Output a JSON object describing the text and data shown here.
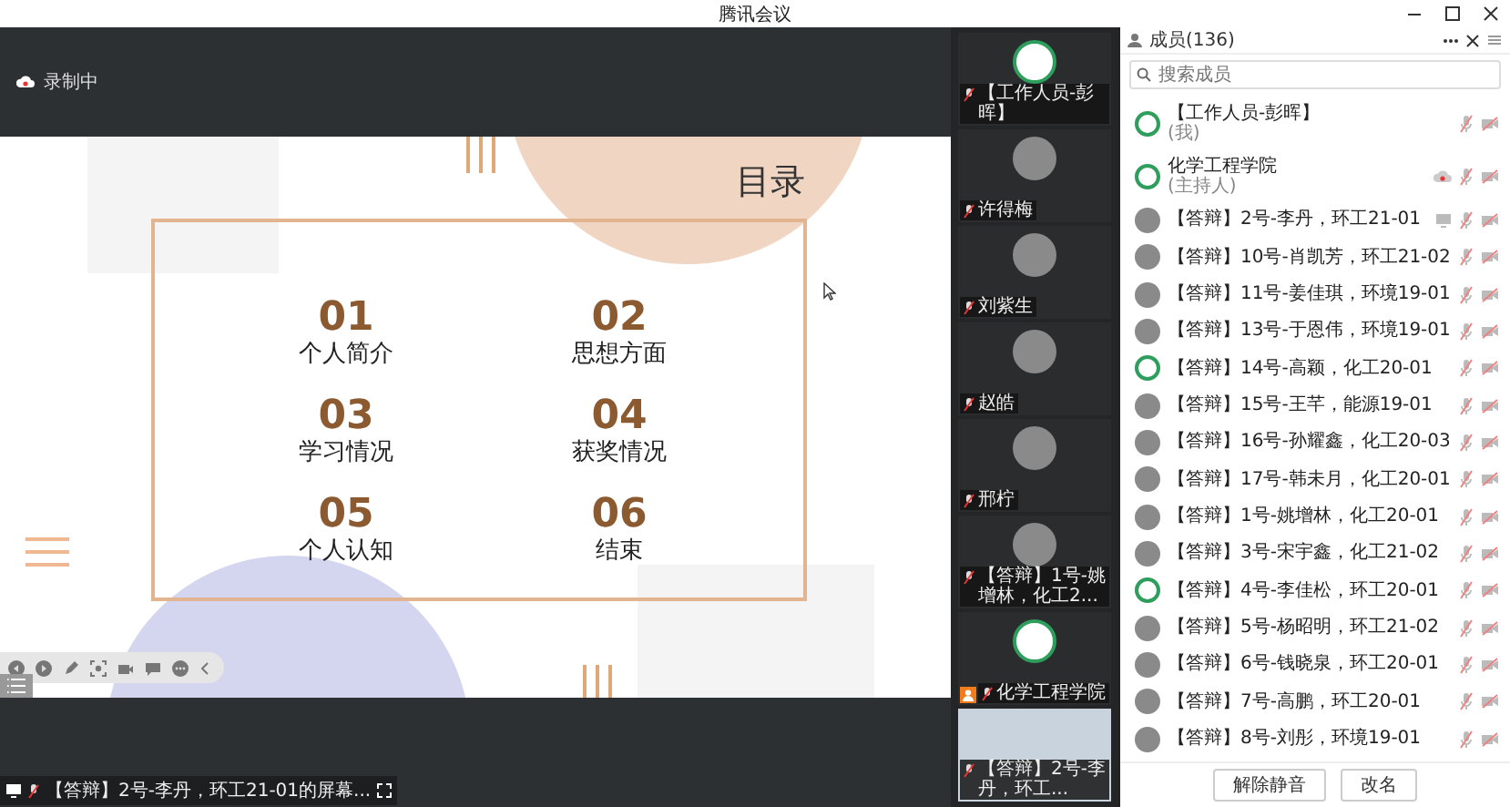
{
  "window": {
    "title": "腾讯会议"
  },
  "recording": {
    "label": "录制中"
  },
  "slide": {
    "title": "目录",
    "items": [
      {
        "number": "01",
        "label": "个人简介"
      },
      {
        "number": "02",
        "label": "思想方面"
      },
      {
        "number": "03",
        "label": "学习情况"
      },
      {
        "number": "04",
        "label": "获奖情况"
      },
      {
        "number": "05",
        "label": "个人认知"
      },
      {
        "number": "06",
        "label": "结束"
      }
    ]
  },
  "screen_share": {
    "label": "【答辩】2号-李丹，环工21-01的屏幕..."
  },
  "video_tiles": [
    {
      "name": "【工作人员-彭晖】",
      "kind": "logo",
      "muted": true,
      "host": false
    },
    {
      "name": "许得梅",
      "kind": "photo",
      "muted": true,
      "host": false
    },
    {
      "name": "刘紫生",
      "kind": "photo",
      "muted": true,
      "host": false
    },
    {
      "name": "赵皓",
      "kind": "photo",
      "muted": true,
      "host": false
    },
    {
      "name": "邢柠",
      "kind": "photo",
      "muted": true,
      "host": false
    },
    {
      "name": "【答辩】1号-姚增林，化工2...",
      "kind": "photo",
      "muted": true,
      "host": false
    },
    {
      "name": "化学工程学院",
      "kind": "logo",
      "muted": true,
      "host": true
    },
    {
      "name": "【答辩】2号-李丹，环工...",
      "kind": "video",
      "muted": true,
      "host": false
    }
  ],
  "members": {
    "title": "成员(136)",
    "search": {
      "placeholder": "搜索成员"
    },
    "items": [
      {
        "name": "【工作人员-彭晖】",
        "role": "(我)",
        "kind": "logo",
        "recording": false,
        "sharing": false,
        "mic_muted": true,
        "camera_off": true
      },
      {
        "name": "化学工程学院",
        "role": "(主持人)",
        "kind": "logo",
        "recording": true,
        "sharing": false,
        "mic_muted": true,
        "camera_off": true
      },
      {
        "name": "【答辩】2号-李丹，环工21-01",
        "kind": "photo",
        "recording": false,
        "sharing": true,
        "mic_muted": true,
        "camera_off": true
      },
      {
        "name": "【答辩】10号-肖凯芳，环工21-02",
        "kind": "photo",
        "recording": false,
        "sharing": false,
        "mic_muted": true,
        "camera_off": true
      },
      {
        "name": "【答辩】11号-姜佳琪，环境19-01",
        "kind": "photo",
        "recording": false,
        "sharing": false,
        "mic_muted": true,
        "camera_off": true
      },
      {
        "name": "【答辩】13号-于恩伟，环境19-01",
        "kind": "photo",
        "recording": false,
        "sharing": false,
        "mic_muted": true,
        "camera_off": true
      },
      {
        "name": "【答辩】14号-高颖，化工20-01",
        "kind": "logo",
        "recording": false,
        "sharing": false,
        "mic_muted": true,
        "camera_off": true
      },
      {
        "name": "【答辩】15号-王芊，能源19-01",
        "kind": "photo",
        "recording": false,
        "sharing": false,
        "mic_muted": true,
        "camera_off": true
      },
      {
        "name": "【答辩】16号-孙耀鑫，化工20-03",
        "kind": "photo",
        "recording": false,
        "sharing": false,
        "mic_muted": true,
        "camera_off": true
      },
      {
        "name": "【答辩】17号-韩未月，化工20-01",
        "kind": "photo",
        "recording": false,
        "sharing": false,
        "mic_muted": true,
        "camera_off": true
      },
      {
        "name": "【答辩】1号-姚增林，化工20-01",
        "kind": "photo",
        "recording": false,
        "sharing": false,
        "mic_muted": true,
        "camera_off": true
      },
      {
        "name": "【答辩】3号-宋宇鑫，化工21-02",
        "kind": "photo",
        "recording": false,
        "sharing": false,
        "mic_muted": true,
        "camera_off": true
      },
      {
        "name": "【答辩】4号-李佳松，环工20-01",
        "kind": "logo",
        "recording": false,
        "sharing": false,
        "mic_muted": true,
        "camera_off": true
      },
      {
        "name": "【答辩】5号-杨昭明，环工21-02",
        "kind": "photo",
        "recording": false,
        "sharing": false,
        "mic_muted": true,
        "camera_off": true
      },
      {
        "name": "【答辩】6号-钱晓泉，环工20-01",
        "kind": "photo",
        "recording": false,
        "sharing": false,
        "mic_muted": true,
        "camera_off": true
      },
      {
        "name": "【答辩】7号-高鹏，环工20-01",
        "kind": "photo",
        "recording": false,
        "sharing": false,
        "mic_muted": true,
        "camera_off": true
      },
      {
        "name": "【答辩】8号-刘彤，环境19-01",
        "kind": "photo",
        "recording": false,
        "sharing": false,
        "mic_muted": true,
        "camera_off": true
      }
    ],
    "buttons": [
      "解除静音",
      "改名"
    ]
  }
}
